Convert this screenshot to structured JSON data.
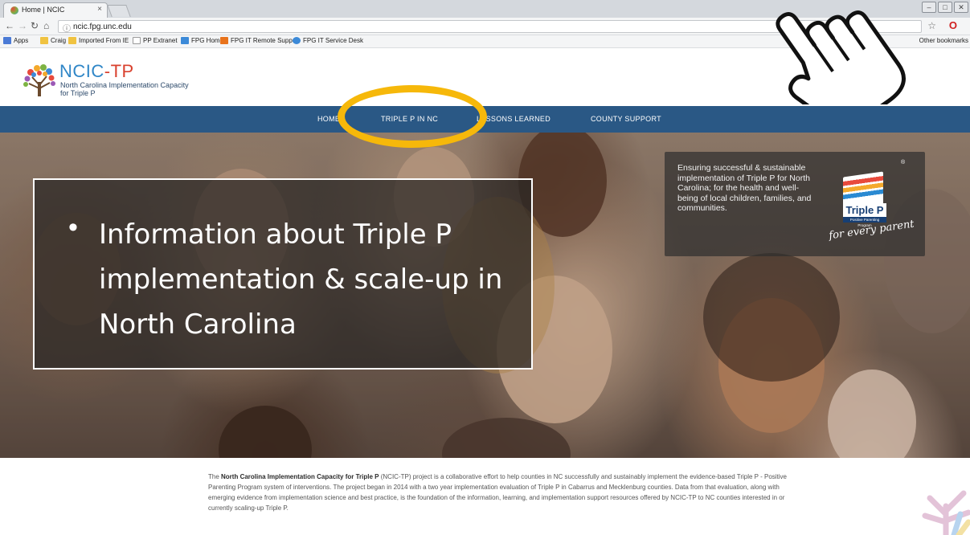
{
  "browser": {
    "tab_title": "Home | NCIC",
    "tab_close": "×",
    "url": "ncic.fpg.unc.edu",
    "bookmarks": [
      {
        "label": "Apps",
        "color": "#4b7bd6"
      },
      {
        "label": "Craig",
        "color": "#f0c341"
      },
      {
        "label": "Imported From IE",
        "color": "#f0c341"
      },
      {
        "label": "PP Extranet",
        "color": "#ffffff"
      },
      {
        "label": "FPG Home",
        "color": "#3c8ad8"
      },
      {
        "label": "FPG IT Remote Support",
        "color": "#e8731c"
      },
      {
        "label": "FPG IT Service Desk",
        "color": "#3c8ad8"
      }
    ],
    "other_bookmarks": "Other bookmarks"
  },
  "site": {
    "logo_title_main": "NCIC",
    "logo_title_accent": "-TP",
    "logo_subtitle": "North Carolina Implementation Capacity for Triple P",
    "nav": [
      "HOME",
      "TRIPLE P IN NC",
      "LESSONS LEARNED",
      "COUNTY SUPPORT"
    ],
    "nav_color": "#2a5885",
    "tagline": "Ensuring successful & sustainable implementation of Triple P for North Carolina; for the health and well-being of local children, families, and communities.",
    "triple_p_logo": {
      "word": "Triple P",
      "small": "Positive Parenting Program",
      "script": "for every parent",
      "reg": "®"
    }
  },
  "callout": {
    "bullet": "•",
    "text": "Information about Triple P implementation & scale-up in North Carolina"
  },
  "highlight_color": "#f6b80a",
  "intro": {
    "prefix": "The ",
    "bold": "North Carolina Implementation Capacity for Triple P",
    "rest": " (NCIC-TP) project is a collaborative effort to help counties in NC successfully and sustainably implement the evidence-based Triple P - Positive Parenting Program system of interventions. The project began in 2014 with a two year implementation evaluation of Triple P in Cabarrus and Mecklenburg counties. Data from that evaluation, along with  emerging evidence from implementation science and best practice, is the foundation of the information, learning, and implementation support resources offered by NCIC-TP to NC counties interested in or currently scaling-up Triple P."
  }
}
